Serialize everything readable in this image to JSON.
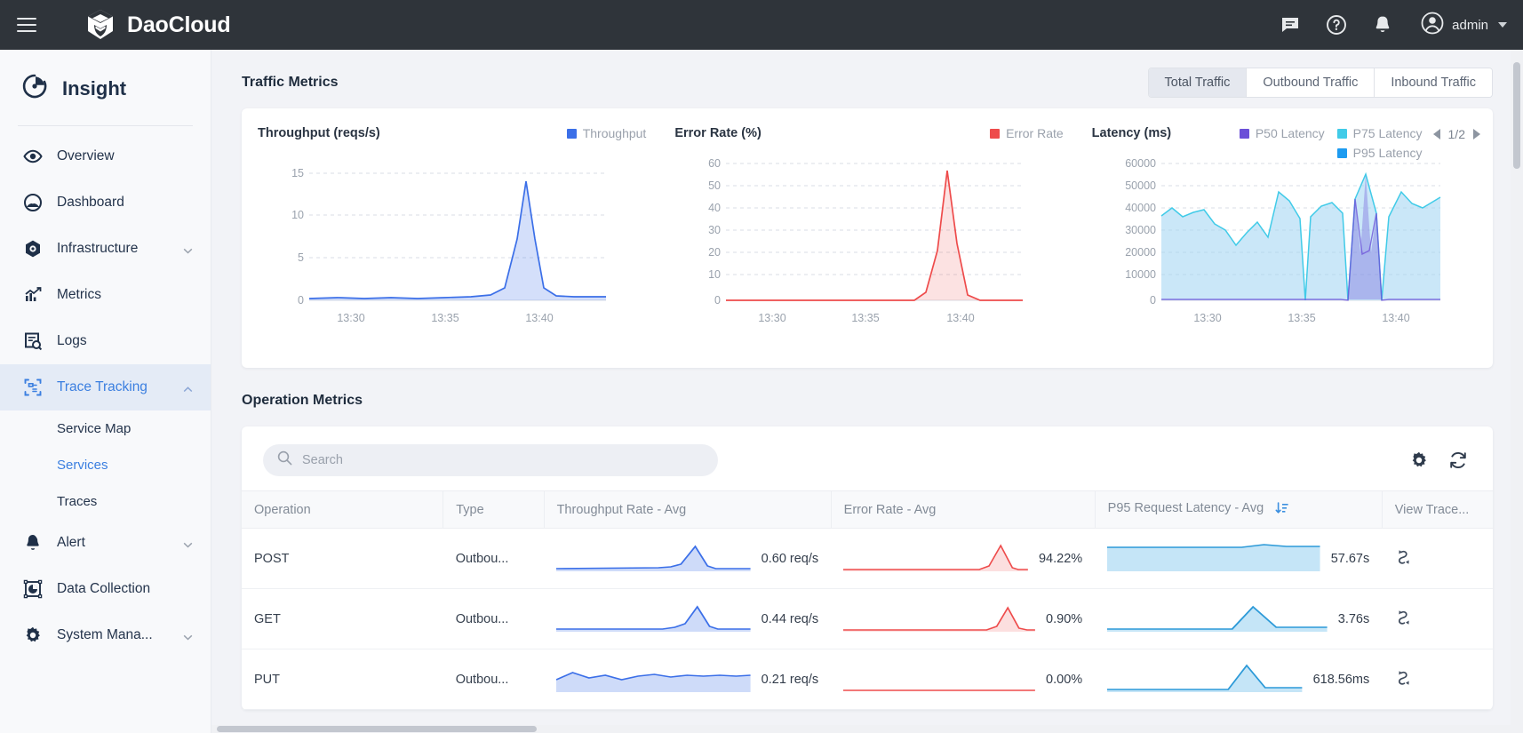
{
  "topbar": {
    "menu_icon": "hamburger-icon",
    "brand": "DaoCloud",
    "icons": [
      "chat-icon",
      "help-icon",
      "bell-icon"
    ],
    "user": "admin"
  },
  "sidebar": {
    "product": "Insight",
    "items": [
      {
        "label": "Overview",
        "icon": "eye-icon",
        "expandable": false,
        "active": false
      },
      {
        "label": "Dashboard",
        "icon": "gauge-icon",
        "expandable": false,
        "active": false
      },
      {
        "label": "Infrastructure",
        "icon": "hexagon-icon",
        "expandable": true,
        "active": false
      },
      {
        "label": "Metrics",
        "icon": "chart-up-icon",
        "expandable": false,
        "active": false
      },
      {
        "label": "Logs",
        "icon": "log-search-icon",
        "expandable": false,
        "active": false
      },
      {
        "label": "Trace Tracking",
        "icon": "trace-icon",
        "expandable": true,
        "active": true
      }
    ],
    "subitems": [
      {
        "label": "Service Map",
        "selected": false
      },
      {
        "label": "Services",
        "selected": true
      },
      {
        "label": "Traces",
        "selected": false
      }
    ],
    "items_after": [
      {
        "label": "Alert",
        "icon": "bell-icon",
        "expandable": true,
        "active": false
      },
      {
        "label": "Data Collection",
        "icon": "data-collection-icon",
        "expandable": false,
        "active": false
      },
      {
        "label": "System Mana...",
        "icon": "gear-icon",
        "expandable": true,
        "active": false
      }
    ]
  },
  "traffic": {
    "title": "Traffic Metrics",
    "tabs": [
      {
        "label": "Total Traffic",
        "selected": true
      },
      {
        "label": "Outbound Traffic",
        "selected": false
      },
      {
        "label": "Inbound Traffic",
        "selected": false
      }
    ],
    "pager": {
      "label": "1/2",
      "prev": "prev-arrow",
      "next": "next-arrow"
    }
  },
  "operation": {
    "title": "Operation Metrics",
    "search_placeholder": "Search",
    "search_value": "",
    "settings_icon": "gear-icon",
    "refresh_icon": "refresh-icon",
    "columns": [
      "Operation",
      "Type",
      "Throughput Rate - Avg",
      "Error Rate - Avg",
      "P95 Request Latency - Avg",
      "View Trace..."
    ],
    "sorted_column_index": 4,
    "rows": [
      {
        "operation": "POST",
        "type": "Outbou...",
        "throughput": "0.60 req/s",
        "error_rate": "94.22%",
        "latency": "57.67s",
        "trace_icon": "trace-link-icon"
      },
      {
        "operation": "GET",
        "type": "Outbou...",
        "throughput": "0.44 req/s",
        "error_rate": "0.90%",
        "latency": "3.76s",
        "trace_icon": "trace-link-icon"
      },
      {
        "operation": "PUT",
        "type": "Outbou...",
        "throughput": "0.21 req/s",
        "error_rate": "0.00%",
        "latency": "618.56ms",
        "trace_icon": "trace-link-icon"
      }
    ]
  },
  "colors": {
    "throughput": "#3b6fe8",
    "error": "#ee4b4b",
    "p50": "#6b4fd8",
    "p75": "#41cbe8",
    "p95": "#1d9bf0",
    "accent": "#3b7fe0"
  },
  "chart_data": [
    {
      "type": "area",
      "title": "Throughput (reqs/s)",
      "xlabel": "",
      "ylabel": "",
      "legend": [
        {
          "name": "Throughput",
          "color": "#3b6fe8"
        }
      ],
      "legend_position": "top-right",
      "grid": true,
      "ylim": [
        0,
        16.5
      ],
      "yticks": [
        0,
        5,
        10,
        15
      ],
      "xticks": [
        "13:30",
        "13:35",
        "13:40"
      ],
      "series": [
        {
          "name": "Throughput",
          "color": "#3b6fe8",
          "values": [
            0.15,
            0.2,
            0.18,
            0.22,
            0.2,
            0.25,
            0.22,
            0.2,
            0.24,
            0.2,
            0.22,
            0.2,
            0.18,
            0.2,
            0.22,
            0.2,
            0.2,
            0.2,
            0.22,
            0.2,
            0.2,
            0.25,
            0.3,
            1.5,
            7.5,
            14.2,
            8.0,
            2.0,
            0.5,
            0.3,
            0.25,
            0.3,
            0.28,
            0.3,
            0.25
          ]
        }
      ]
    },
    {
      "type": "area",
      "title": "Error Rate (%)",
      "xlabel": "",
      "ylabel": "",
      "legend": [
        {
          "name": "Error Rate",
          "color": "#ee4b4b"
        }
      ],
      "legend_position": "top-right",
      "grid": true,
      "ylim": [
        0,
        66
      ],
      "yticks": [
        0,
        10,
        20,
        30,
        40,
        50,
        60
      ],
      "xticks": [
        "13:30",
        "13:35",
        "13:40"
      ],
      "series": [
        {
          "name": "Error Rate",
          "color": "#ee4b4b",
          "values": [
            0,
            0,
            0,
            0,
            0,
            0,
            0,
            0,
            0,
            0,
            0,
            0,
            0,
            0,
            0,
            0,
            0,
            0,
            0,
            0,
            0,
            0,
            0,
            2,
            22,
            56,
            30,
            6,
            0,
            0,
            0,
            0,
            0,
            0,
            0
          ]
        }
      ]
    },
    {
      "type": "area",
      "title": "Latency (ms)",
      "xlabel": "",
      "ylabel": "",
      "legend": [
        {
          "name": "P50 Latency",
          "color": "#6b4fd8"
        },
        {
          "name": "P75 Latency",
          "color": "#41cbe8"
        },
        {
          "name": "P95 Latency",
          "color": "#1d9bf0"
        }
      ],
      "legend_position": "top-right",
      "grid": true,
      "ylim": [
        0,
        64000
      ],
      "yticks": [
        0,
        10000,
        20000,
        30000,
        40000,
        50000,
        60000
      ],
      "xticks": [
        "13:30",
        "13:35",
        "13:40"
      ],
      "series": [
        {
          "name": "P95 Latency",
          "color": "#1d9bf0",
          "values": [
            38000,
            41000,
            37000,
            39000,
            40000,
            35000,
            33000,
            25000,
            30000,
            34000,
            29000,
            45000,
            42000,
            36000,
            100,
            33000,
            38000,
            40000,
            36000,
            100,
            42000,
            54000,
            38000,
            100,
            36000,
            46000
          ]
        },
        {
          "name": "P75 Latency",
          "color": "#41cbe8",
          "values": [
            36000,
            39000,
            34000,
            36000,
            37000,
            32000,
            30000,
            23000,
            28000,
            31000,
            27000,
            42000,
            39000,
            33000,
            100,
            30000,
            35000,
            37000,
            33000,
            100,
            39000,
            50000,
            35000,
            100,
            33000,
            43000
          ]
        },
        {
          "name": "P50 Latency",
          "color": "#6b4fd8",
          "values": [
            200,
            200,
            200,
            200,
            200,
            200,
            200,
            200,
            200,
            200,
            200,
            200,
            200,
            200,
            100,
            200,
            200,
            200,
            39000,
            100,
            21000,
            300,
            300,
            100,
            300,
            300
          ]
        }
      ]
    }
  ],
  "sparklines": {
    "throughput": [
      [
        0.05,
        0.05,
        0.05,
        0.05,
        0.05,
        0.06,
        0.05,
        0.05,
        0.06,
        0.05,
        0.05,
        0.06,
        0.08,
        0.4,
        1.0,
        0.45,
        0.08,
        0.05,
        0.05,
        0.05
      ],
      [
        0.04,
        0.04,
        0.04,
        0.05,
        0.04,
        0.05,
        0.04,
        0.05,
        0.04,
        0.05,
        0.05,
        0.05,
        0.08,
        0.4,
        1.0,
        0.45,
        0.08,
        0.05,
        0.04,
        0.04
      ],
      [
        0.35,
        0.55,
        0.42,
        0.38,
        0.48,
        0.4,
        0.52,
        0.46,
        0.4,
        0.55,
        0.5,
        0.42,
        0.48,
        0.52,
        0.45,
        0.5,
        0.47,
        0.52,
        0.5,
        0.48
      ]
    ],
    "error": [
      [
        0.03,
        0.03,
        0.03,
        0.03,
        0.03,
        0.03,
        0.03,
        0.03,
        0.03,
        0.03,
        0.03,
        0.03,
        0.05,
        0.45,
        1.0,
        0.4,
        0.05,
        0.03,
        0.03,
        0.03
      ],
      [
        0.02,
        0.02,
        0.02,
        0.02,
        0.02,
        0.02,
        0.02,
        0.02,
        0.02,
        0.02,
        0.02,
        0.02,
        0.04,
        0.42,
        1.0,
        0.4,
        0.04,
        0.02,
        0.02,
        0.02
      ],
      [
        0,
        0,
        0,
        0,
        0,
        0,
        0,
        0,
        0,
        0,
        0,
        0,
        0,
        0,
        0,
        0,
        0,
        0,
        0,
        0
      ]
    ],
    "latency": [
      [
        0.9,
        0.9,
        0.9,
        0.9,
        0.9,
        0.9,
        0.9,
        0.9,
        0.9,
        0.9,
        0.9,
        0.9,
        0.91,
        0.93,
        0.95,
        0.94,
        0.93,
        0.93,
        0.93,
        0.93
      ],
      [
        0.03,
        0.03,
        0.03,
        0.03,
        0.03,
        0.03,
        0.03,
        0.03,
        0.03,
        0.03,
        0.05,
        0.25,
        0.65,
        1.0,
        0.6,
        0.25,
        0.05,
        0.03,
        0.03,
        0.03
      ],
      [
        0.02,
        0.02,
        0.02,
        0.02,
        0.02,
        0.02,
        0.02,
        0.02,
        0.03,
        0.05,
        0.1,
        0.35,
        0.72,
        1.0,
        0.7,
        0.3,
        0.08,
        0.03,
        0.02,
        0.02
      ]
    ]
  }
}
